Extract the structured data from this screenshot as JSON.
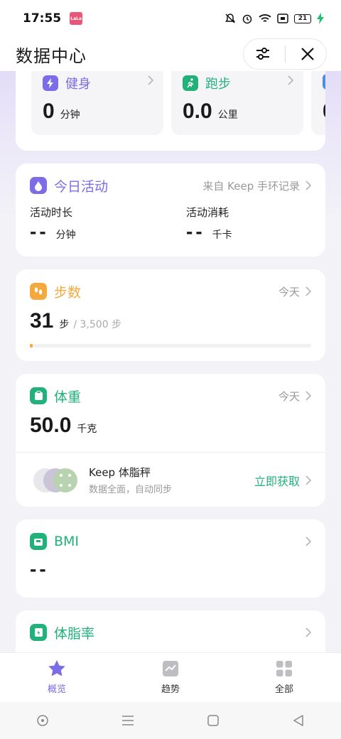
{
  "status": {
    "time": "17:55",
    "app_badge": "LaLa",
    "battery": "21"
  },
  "header": {
    "title": "数据中心"
  },
  "sports": [
    {
      "label": "健身",
      "value": "0",
      "unit": "分钟",
      "color": "#7b6ce8"
    },
    {
      "label": "跑步",
      "value": "0.0",
      "unit": "公里",
      "color": "#22b17a"
    }
  ],
  "activity": {
    "title": "今日活动",
    "source": "来自 Keep 手环记录",
    "duration_label": "活动时长",
    "duration_value": "--",
    "duration_unit": "分钟",
    "calories_label": "活动消耗",
    "calories_value": "--",
    "calories_unit": "千卡",
    "color": "#7b6ce8"
  },
  "steps": {
    "title": "步数",
    "period": "今天",
    "value": "31",
    "unit": "步",
    "goal": "/ 3,500 步",
    "progress_fraction": 0.009,
    "color": "#f5a93d"
  },
  "weight": {
    "title": "体重",
    "period": "今天",
    "value": "50.0",
    "unit": "千克",
    "promo_title": "Keep 体脂秤",
    "promo_sub": "数据全面，自动同步",
    "promo_action": "立即获取",
    "color": "#22b17a"
  },
  "bmi": {
    "title": "BMI",
    "value": "--",
    "color": "#22b17a"
  },
  "body_fat": {
    "title": "体脂率",
    "color": "#22b17a"
  },
  "nav": [
    {
      "label": "概览",
      "active": true
    },
    {
      "label": "趋势",
      "active": false
    },
    {
      "label": "全部",
      "active": false
    }
  ]
}
